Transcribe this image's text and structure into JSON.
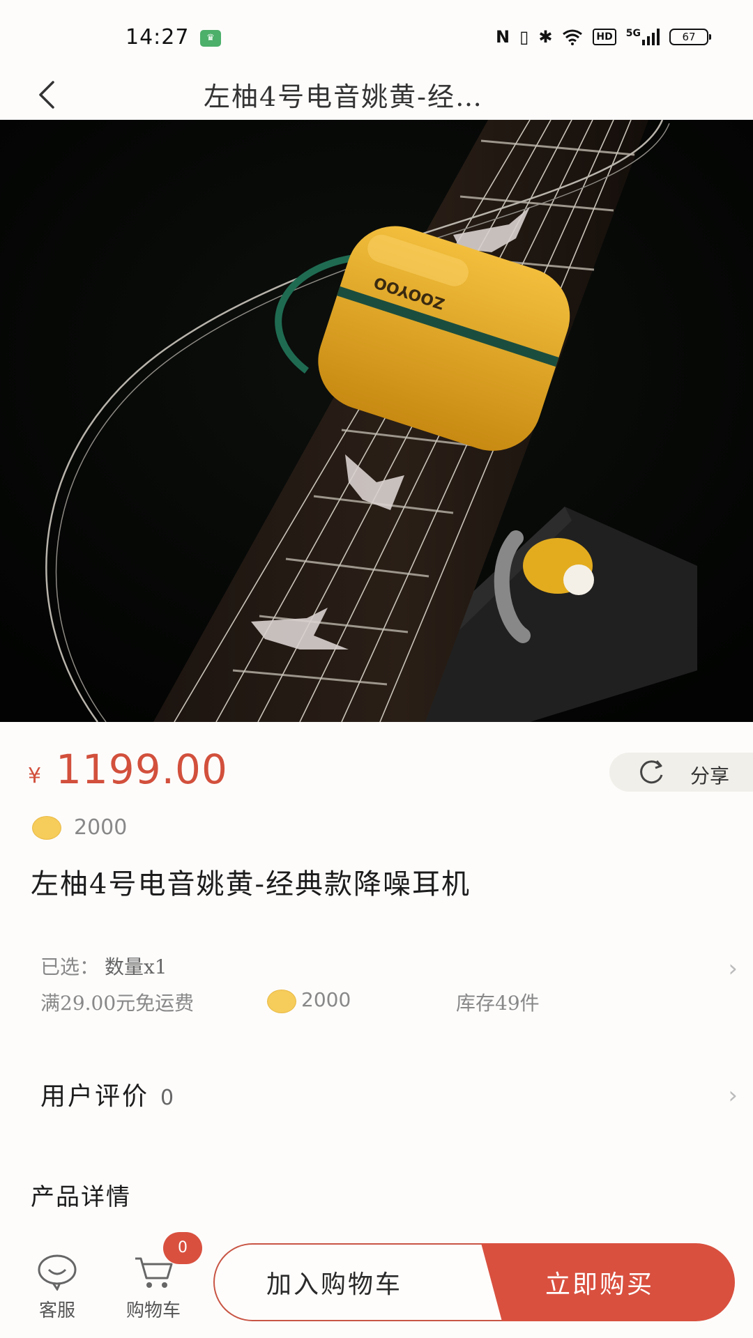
{
  "status_bar": {
    "time": "14:27",
    "app_badge": "♛",
    "nfc": "N",
    "vibrate": "▯",
    "bluetooth": "✱",
    "wifi": "◔",
    "hd": "HD",
    "network": "5G",
    "battery": "67"
  },
  "nav": {
    "title": "左柚4号电音姚黄-经…"
  },
  "product": {
    "currency": "¥",
    "price": "1199.00",
    "share_label": "分享",
    "points": "2000",
    "title": "左柚4号电音姚黄-经典款降噪耳机",
    "selected_label": "已选：",
    "selected_value": "数量x1",
    "shipping": "满29.00元免运费",
    "info_points": "2000",
    "stock": "库存49件",
    "review_label": "用户评价",
    "review_count": "0",
    "detail_title": "产品详情",
    "image_logo": "ZOOYOO"
  },
  "bottom_bar": {
    "service_label": "客服",
    "cart_label": "购物车",
    "cart_count": "0",
    "add_cart_label": "加入购物车",
    "buy_now_label": "立即购买"
  },
  "colors": {
    "accent": "#d9503f",
    "price": "#d2503c",
    "coin": "#f6cc5a"
  }
}
